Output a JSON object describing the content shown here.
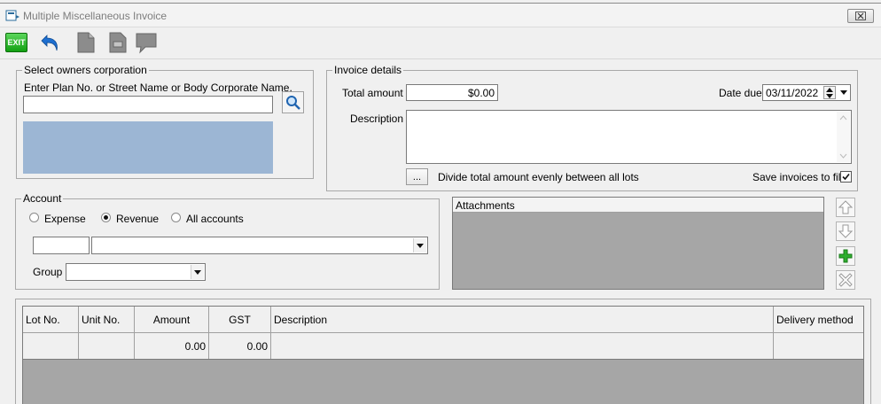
{
  "window": {
    "title": "Multiple Miscellaneous Invoice",
    "close_label": "☒"
  },
  "toolbar": {
    "exit_label": "EXIT"
  },
  "owners": {
    "legend": "Select owners corporation",
    "prompt": "Enter Plan No. or Street Name or Body Corporate Name.",
    "search_value": ""
  },
  "invoice": {
    "legend": "Invoice details",
    "total_label": "Total amount",
    "total_value": "$0.00",
    "date_label": "Date due",
    "date_value": "03/11/2022",
    "description_label": "Description",
    "description_value": "",
    "divide_button": "...",
    "divide_label": "Divide total amount evenly between all lots",
    "save_label": "Save invoices to file",
    "save_checked": true
  },
  "account": {
    "legend": "Account",
    "radio_expense": "Expense",
    "radio_revenue": "Revenue",
    "radio_all": "All accounts",
    "selected": "Revenue",
    "code_value": "",
    "account_value": "",
    "group_label": "Group",
    "group_value": ""
  },
  "attachments": {
    "header": "Attachments"
  },
  "grid": {
    "columns": [
      "Lot No.",
      "Unit No.",
      "Amount",
      "GST",
      "Description",
      "Delivery method"
    ],
    "totals": {
      "amount": "0.00",
      "gst": "0.00"
    }
  },
  "colors": {
    "list_blue": "#9cb6d4",
    "grid_gray": "#a6a6a6"
  }
}
